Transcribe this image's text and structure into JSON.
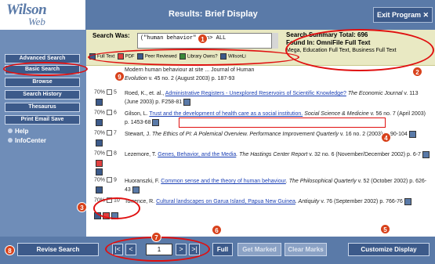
{
  "header": {
    "logo_main": "Wilson",
    "logo_sub": "Web",
    "title": "Results: Brief Display",
    "exit_label": "Exit Program ✕"
  },
  "sidebar": {
    "buttons": [
      "Advanced Search",
      "Basic Search",
      "Browse",
      "Search History",
      "Thesaurus",
      "Print Email Save"
    ],
    "links": [
      "Help",
      "InfoCenter"
    ]
  },
  "search": {
    "label": "Search Was:",
    "query": "(\"human behavior\" <in> ALL",
    "summary_total": "Search Summary Total: 696",
    "found_in": "Found In: OmniFile Full Text",
    "found_more": "Mega, Education Full Text, Business Full Text",
    "filters": [
      "Full Text",
      "PDF",
      "Peer Reviewed",
      "Library Owns?",
      "WilsonLi"
    ]
  },
  "results": [
    {
      "rank": "",
      "text_pre": "",
      "title": "",
      "journal": "Evolution",
      "tail": " v. 45 no. 2 (August 2003) p. 187-93",
      "prefix_line": "Modern human behaviour at site ... Journal of Human"
    },
    {
      "rank": "70%",
      "num": "5",
      "author": "Roed, K., et. al., ",
      "title": "Administrative Registers - Unexplored Reservoirs of Scientific Knowledge?",
      "journal": "The Economic Journal",
      "tail": " v. 113 (June 2003) p. F258-81"
    },
    {
      "rank": "70%",
      "num": "6",
      "author": "Gilson, L. ",
      "title": "Trust and the development of health care as a social institution.",
      "journal": "Social Science & Medicine",
      "tail": " v. 56 no. 7 (April 2003) p. 1453-68"
    },
    {
      "rank": "70%",
      "num": "7",
      "author": "Stewart, J. ",
      "title": "",
      "journal": "The Ethics of PI: A Polemical Overview. Performance Improvement Quarterly",
      "tail": " v. 16 no. 2 (2003) p. 90-104"
    },
    {
      "rank": "70%",
      "num": "8",
      "author": "Lezemore, T. ",
      "title": "Genes, Behavior, and the Media",
      "journal": ". The Hastings Center Report",
      "tail": " v. 32 no. 6 (November/December 2002) p. 6-7"
    },
    {
      "rank": "70%",
      "num": "9",
      "author": "Huoranszki, F. ",
      "title": "Common sense and the theory of human behaviour",
      "journal": ". The Philosophical Quarterly",
      "tail": " v. 52 (October 2002) p. 626-43"
    },
    {
      "rank": "70%",
      "num": "10",
      "author": "Torrence, R. ",
      "title": "Cultural landscapes on Garua Island, Papua New Guinea",
      "journal": ". Antiquity",
      "tail": " v. 76 (September 2002) p. 766-76"
    }
  ],
  "bottom": {
    "revise": "Revise Search",
    "page": "1",
    "full": "Full",
    "get_marked": "Get Marked",
    "clear_marks": "Clear Marks",
    "customize": "Customize Display"
  },
  "markers": [
    "1",
    "2",
    "3",
    "4",
    "5",
    "6",
    "7",
    "8",
    "9"
  ],
  "colors": {
    "header_blue": "#5a7aa8",
    "panel_yellow": "#e9e9c3",
    "highlight_red": "#e01010",
    "marker_orange": "#d8421c"
  }
}
